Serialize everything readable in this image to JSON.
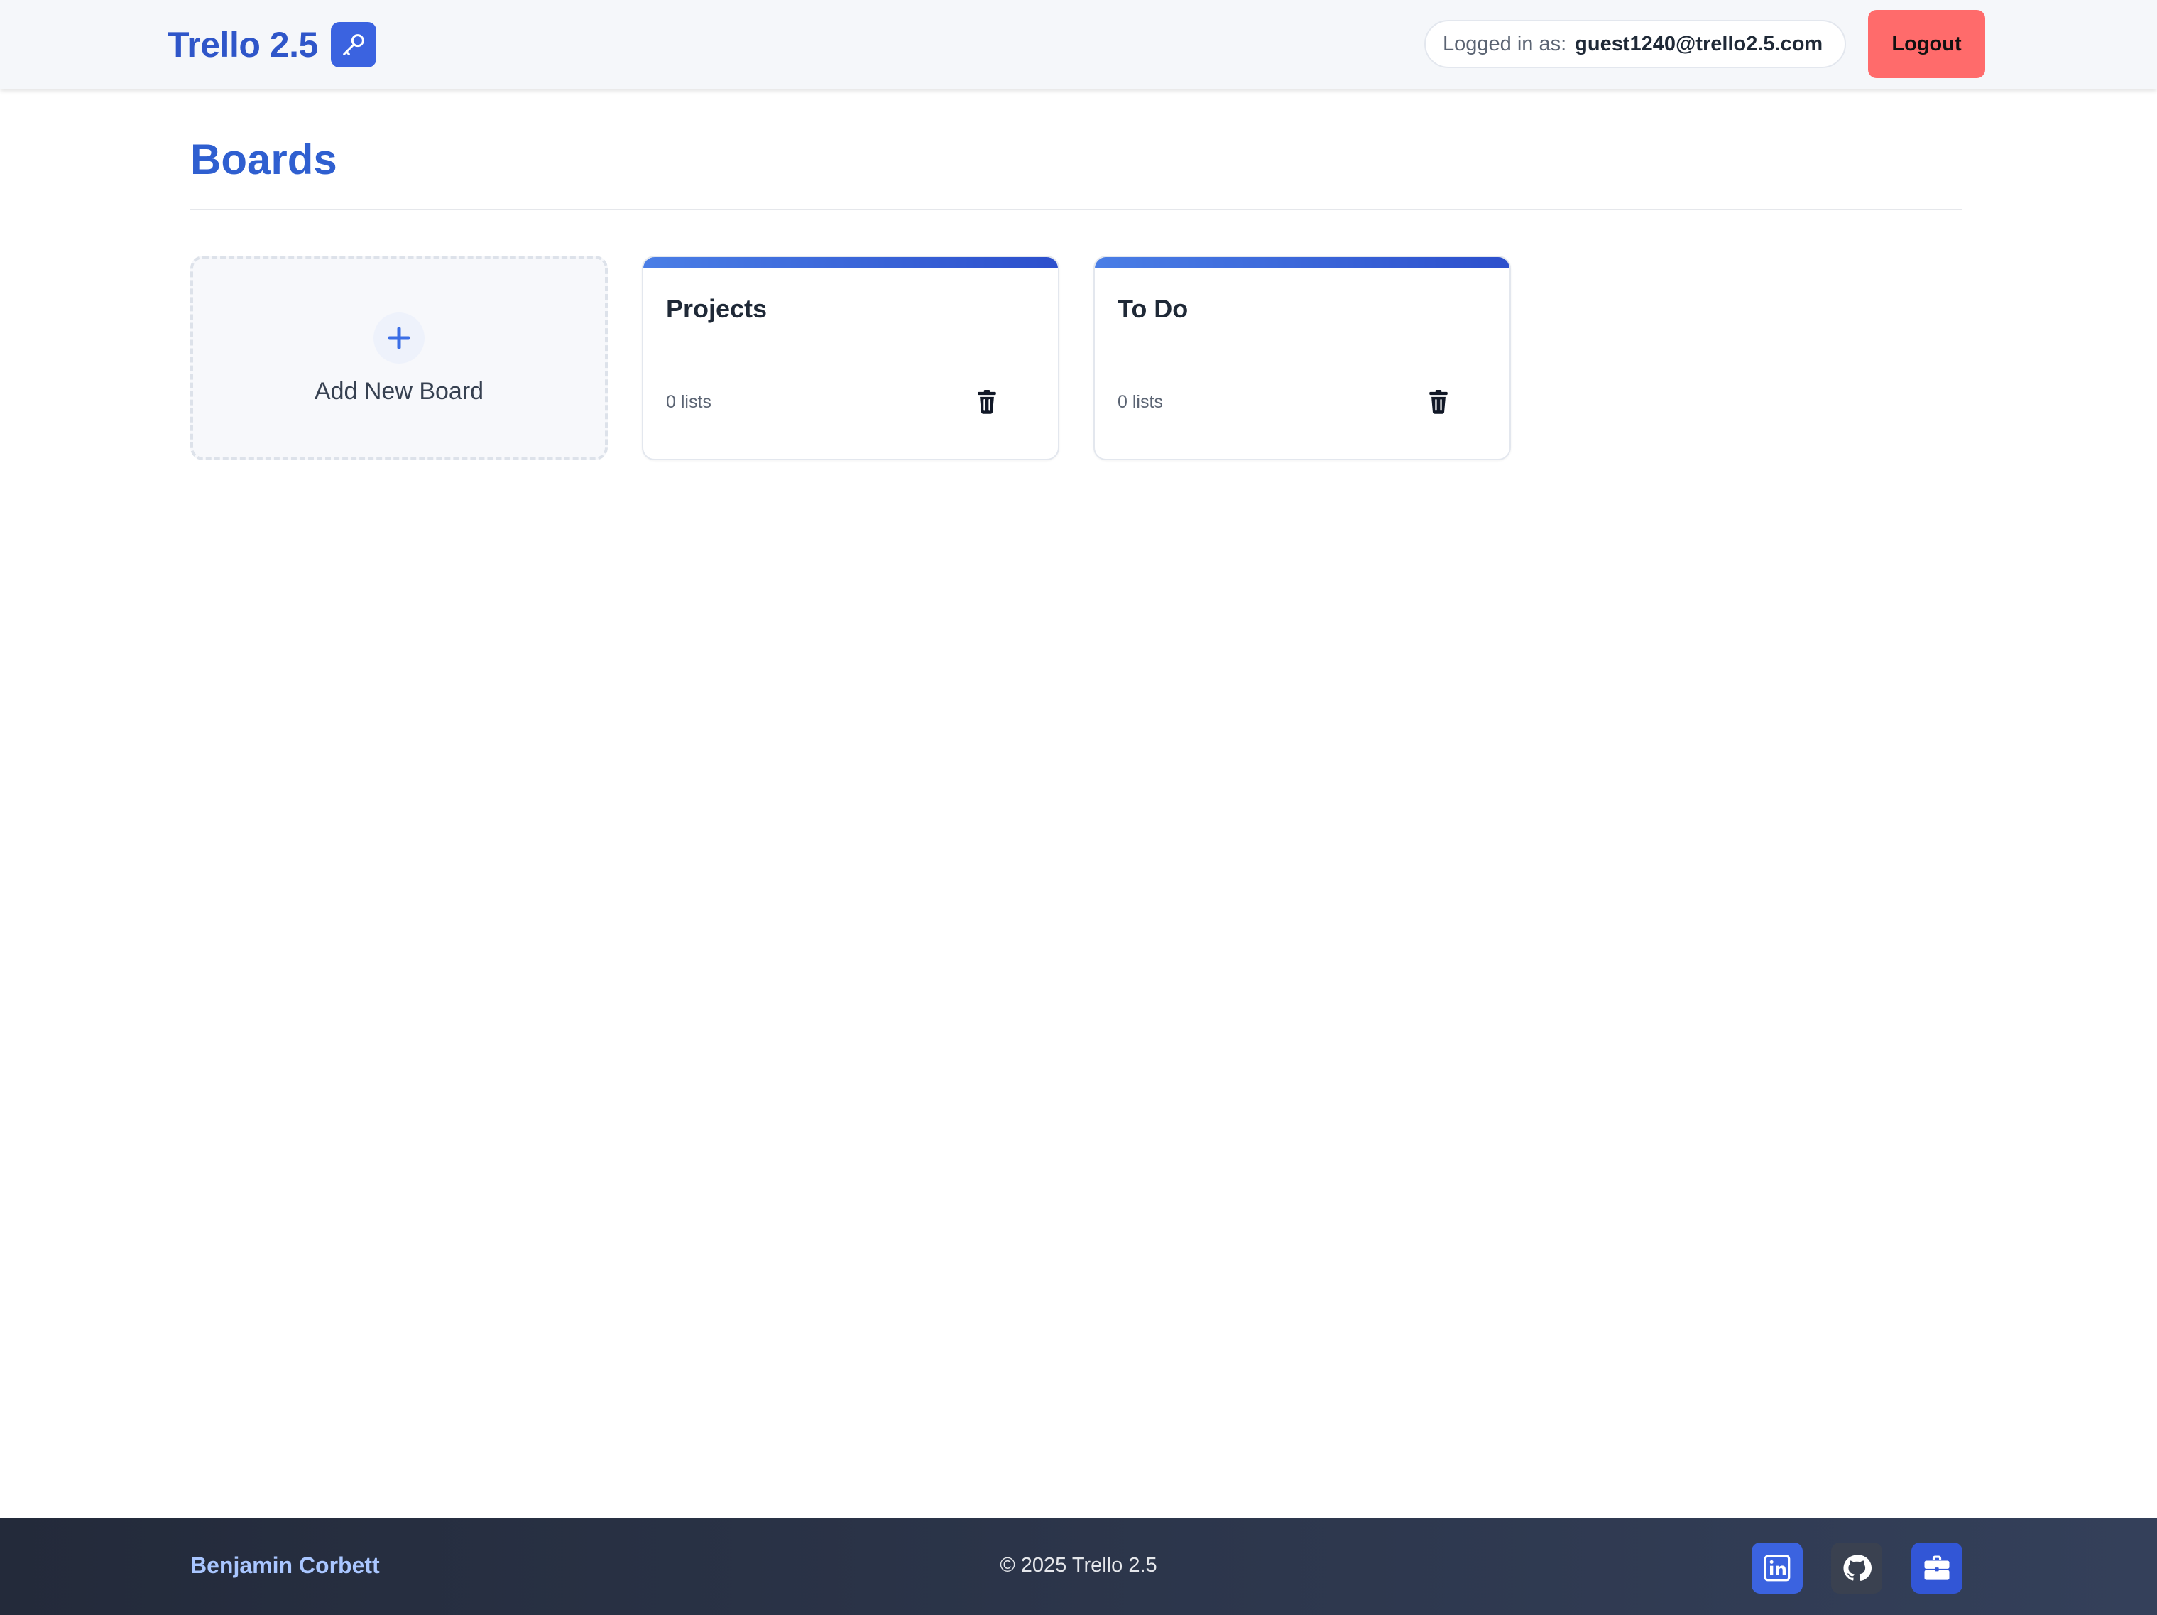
{
  "header": {
    "brand_title": "Trello 2.5",
    "brand_icon": "key-icon",
    "logged_in_label": "Logged in as:",
    "user_email": "guest1240@trello2.5.com",
    "logout_label": "Logout"
  },
  "main": {
    "page_title": "Boards",
    "add_board_label": "Add New Board",
    "boards": [
      {
        "name": "Projects",
        "count_label": "0 lists",
        "delete_icon": "trash-icon"
      },
      {
        "name": "To Do",
        "count_label": "0 lists",
        "delete_icon": "trash-icon"
      }
    ]
  },
  "footer": {
    "author": "Benjamin Corbett",
    "copyright": "© 2025 Trello 2.5",
    "social_icons": [
      "linkedin-icon",
      "github-icon",
      "briefcase-icon"
    ]
  },
  "colors": {
    "brand_blue": "#2f56c9",
    "accent_blue": "#3b63e0",
    "logout_red": "#ff6b6b",
    "footer_dark": "#232a3a",
    "footer_name": "#a9c6ff"
  }
}
